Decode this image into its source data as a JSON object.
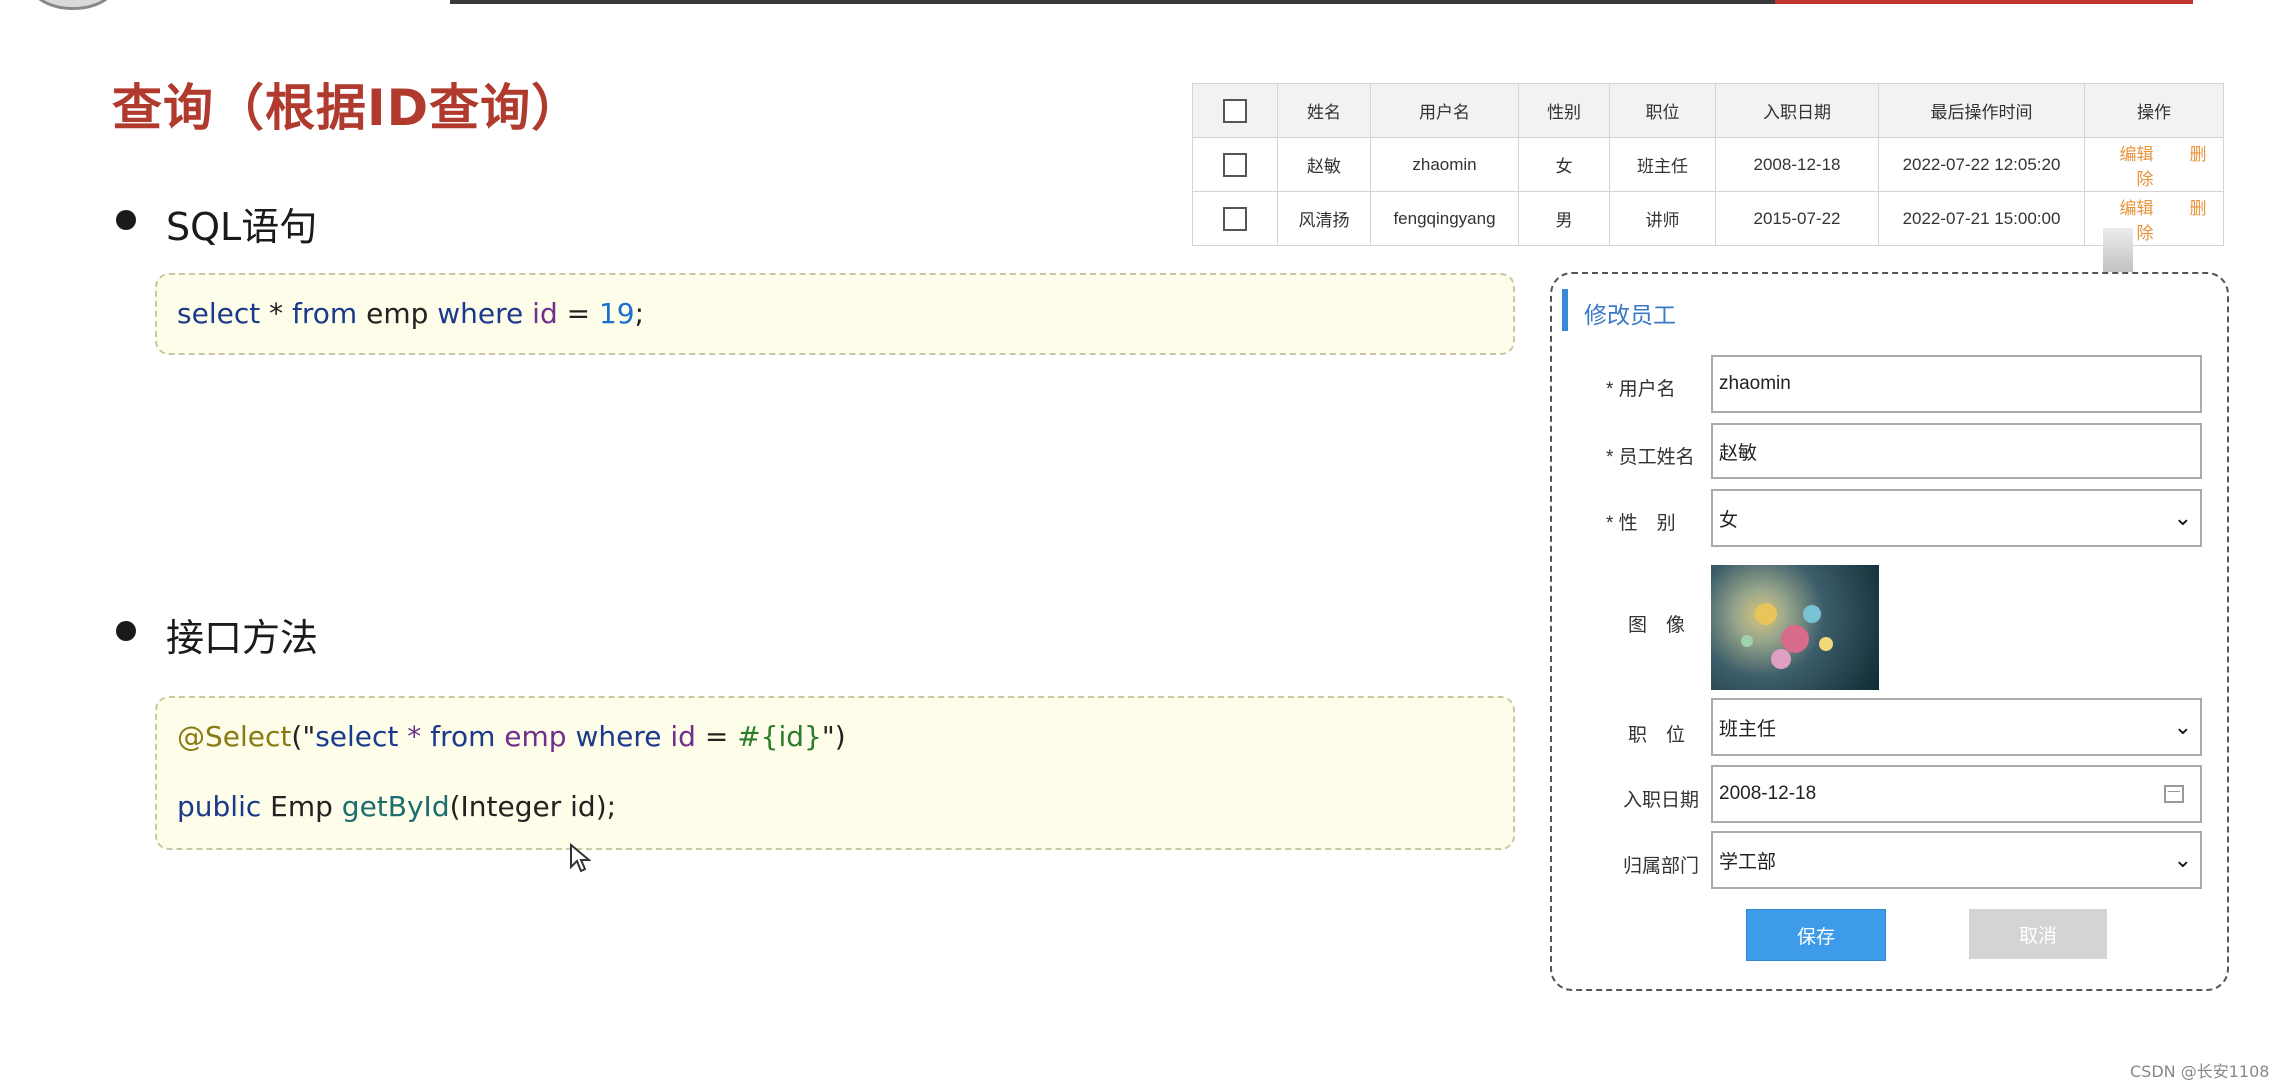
{
  "title": "查询（根据ID查询）",
  "sections": {
    "sql_label": "SQL语句",
    "interface_label": "接口方法"
  },
  "sql_code": {
    "select": "select",
    "star": " * ",
    "from": "from",
    "table": " emp ",
    "where": "where",
    "id": " id",
    "eq": " = ",
    "val": "19",
    "end": ";"
  },
  "iface_code": {
    "annotation": "@Select",
    "open": "(\"",
    "select": "select",
    "star": " * ",
    "from": "from",
    "table": " emp ",
    "where": "where",
    "id": " id",
    "eq": " = ",
    "param": "#{id}",
    "close": "\")",
    "public": "public",
    "type": " Emp ",
    "method": "getById",
    "args": "(Integer id);"
  },
  "table": {
    "headers": [
      "姓名",
      "用户名",
      "性别",
      "职位",
      "入职日期",
      "最后操作时间",
      "操作"
    ],
    "rows": [
      {
        "name": "赵敏",
        "username": "zhaomin",
        "gender": "女",
        "position": "班主任",
        "entry_date": "2008-12-18",
        "last_op": "2022-07-22 12:05:20",
        "edit": "编辑",
        "delete": "删除"
      },
      {
        "name": "风清扬",
        "username": "fengqingyang",
        "gender": "男",
        "position": "讲师",
        "entry_date": "2015-07-22",
        "last_op": "2022-07-21 15:00:00",
        "edit": "编辑",
        "delete": "删除"
      }
    ]
  },
  "edit_form": {
    "title": "修改员工",
    "username_label": "* 用户名",
    "username_value": "zhaomin",
    "name_label": "* 员工姓名",
    "name_value": "赵敏",
    "gender_label": "* 性　别",
    "gender_value": "女",
    "image_label": "图　像",
    "position_label": "职　位",
    "position_value": "班主任",
    "entry_label": "入职日期",
    "entry_value": "2008-12-18",
    "dept_label": "归属部门",
    "dept_value": "学工部",
    "save_label": "保存",
    "cancel_label": "取消"
  },
  "watermark": "CSDN @长安1108",
  "colors": {
    "title": "#b03a2e",
    "accent_blue": "#3d9be9",
    "link_orange": "#e8933a",
    "code_bg": "#fefde9"
  }
}
